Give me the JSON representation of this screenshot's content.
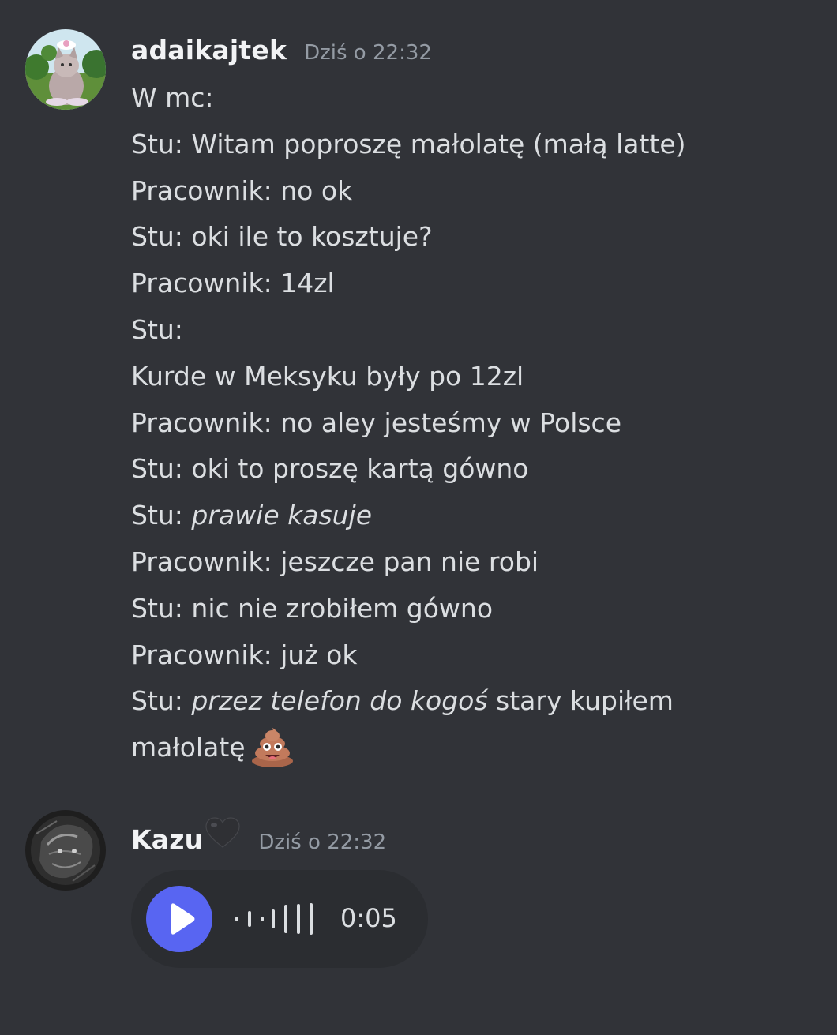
{
  "messages": [
    {
      "username": "adaikajtek",
      "timestamp": "Dziś o 22:32",
      "lines": [
        "W mc:",
        "Stu: Witam poproszę małolatę (małą latte)",
        "Pracownik: no ok",
        "Stu: oki ile to kosztuje?",
        "Pracownik: 14zl",
        "Stu:",
        "Kurde w Meksyku były po 12zl",
        "Pracownik: no aley jesteśmy w Polsce",
        "Stu: oki to proszę kartą gówno"
      ],
      "line_kasuje": {
        "prefix": "Stu: ",
        "italic": "prawie kasuje"
      },
      "lines_after": [
        "Pracownik: jeszcze pan nie robi",
        "Stu: nic nie zrobiłem gówno",
        "Pracownik: już ok"
      ],
      "line_telefon": {
        "prefix": "Stu: ",
        "italic": "przez telefon do kogoś",
        "suffix": " stary kupiłem"
      },
      "line_last": {
        "text": "małolatę",
        "emoji": "pile-of-poo-icon"
      }
    },
    {
      "username": "Kazu",
      "username_emoji": "black-heart-icon",
      "timestamp": "Dziś o 22:32",
      "voice_message": {
        "duration": "0:05",
        "button_icon": "play-icon",
        "accent_color": "#5865f2"
      }
    }
  ],
  "colors": {
    "background": "#313338",
    "username": "#f2f3f5",
    "timestamp": "#949ba4",
    "text": "#dbdee1",
    "voice_bg": "#2b2d31"
  }
}
